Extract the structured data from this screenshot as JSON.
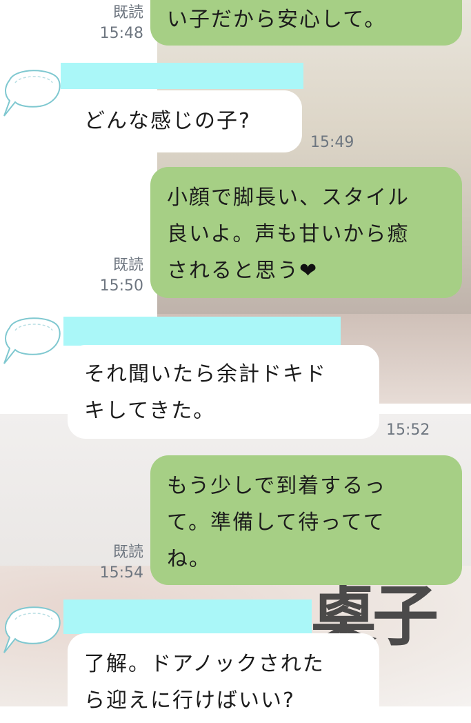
{
  "colors": {
    "outgoing_bubble": "#a6cf85",
    "incoming_bubble": "#ffffff",
    "redaction_bar": "#aaf7f8",
    "meta_text": "#6e7680"
  },
  "icons": {
    "avatar": "speech-bubble-outline-icon"
  },
  "messages": [
    {
      "side": "outgoing",
      "text": "い子だから安心して。",
      "read": "既読",
      "time": "15:48"
    },
    {
      "side": "incoming",
      "text": "どんな感じの子?",
      "time": "15:49"
    },
    {
      "side": "outgoing",
      "text": "小顔で脚長い、スタイル\n良いよ。声も甘いから癒\nされると思う",
      "emoji": "❤",
      "read": "既読",
      "time": "15:50"
    },
    {
      "side": "incoming",
      "text": "それ聞いたら余計ドキド\nキしてきた。",
      "time": "15:52"
    },
    {
      "side": "outgoing",
      "text": "もう少しで到着するっ\nて。準備して待ってて\nね。",
      "read": "既読",
      "time": "15:54"
    },
    {
      "side": "incoming",
      "text": "了解。ドアノックされた\nら迎えに行けばいい?"
    }
  ]
}
